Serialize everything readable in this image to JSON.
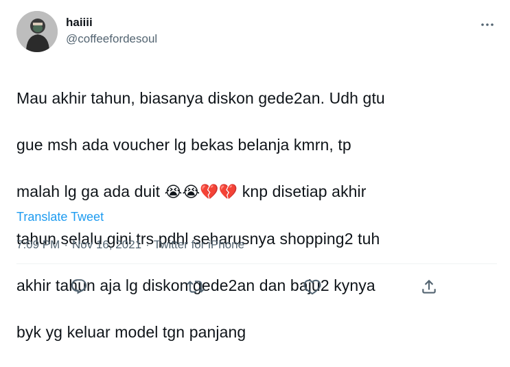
{
  "user": {
    "display_name": "haiiii",
    "handle": "@coffeefordesoul"
  },
  "tweet": {
    "line1": "Mau akhir tahun, biasanya diskon gede2an. Udh gtu",
    "line2": "gue msh ada voucher lg bekas belanja kmrn, tp",
    "line3_before": "malah lg ga ada duit ",
    "line3_emoji": "😭😭💔💔",
    "line3_after": " knp disetiap akhir",
    "line4": "tahun selalu gini trs pdhl seharusnya shopping2 tuh",
    "line5": "akhir tahun aja lg diskon gede2an dan baju2 kynya",
    "line6": "byk yg keluar model tgn panjang"
  },
  "translate_label": "Translate Tweet",
  "meta": {
    "time": "7:09 PM",
    "sep1": "·",
    "date": "Nov 16, 2021",
    "sep2": "·",
    "source": "Twitter for iPhone"
  },
  "icons": {
    "more": "more-horizontal-icon",
    "reply": "reply-icon",
    "retweet": "retweet-icon",
    "like": "like-icon",
    "share": "share-icon"
  },
  "colors": {
    "text": "#0f1419",
    "secondary": "#536471",
    "link": "#1d9bf0",
    "divider": "#eff3f4"
  }
}
